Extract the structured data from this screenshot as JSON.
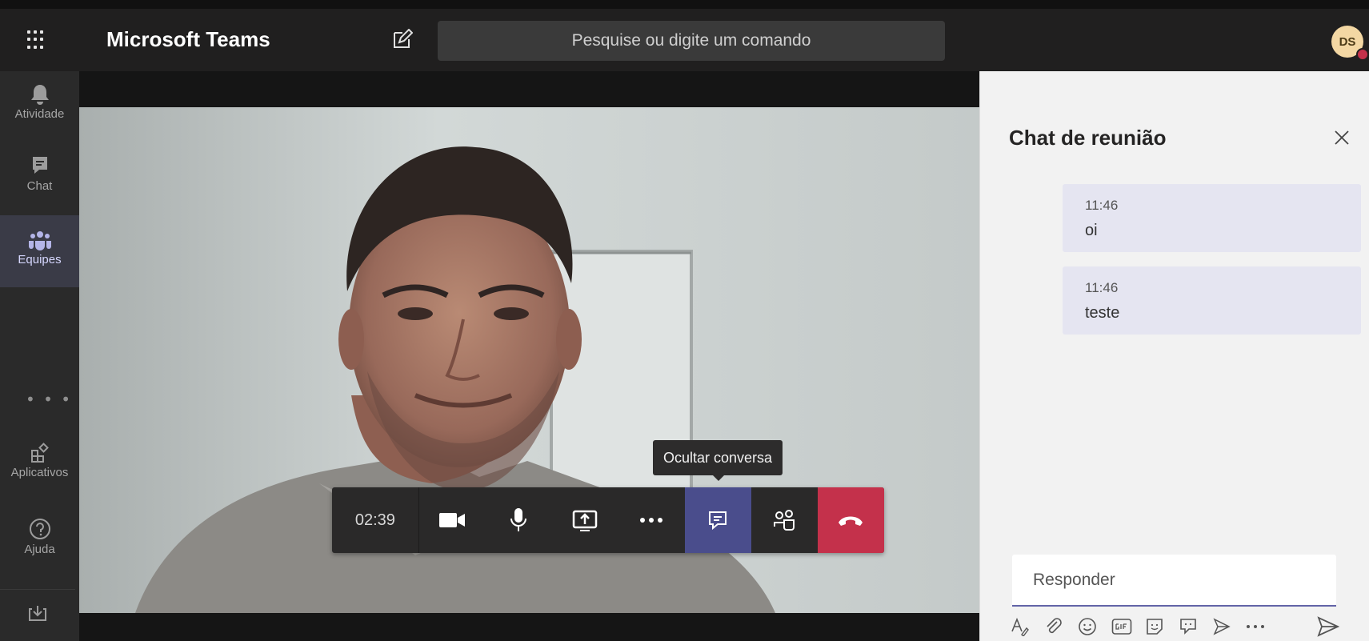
{
  "app": {
    "title": "Microsoft Teams"
  },
  "search": {
    "placeholder": "Pesquise ou digite um comando"
  },
  "user": {
    "initials": "DS",
    "presence_color": "#c4314b"
  },
  "rail": {
    "items": [
      {
        "label": "Atividade",
        "icon": "bell-icon"
      },
      {
        "label": "Chat",
        "icon": "chat-icon"
      },
      {
        "label": "Equipes",
        "icon": "teams-icon",
        "active": true
      },
      {
        "label": "Aplicativos",
        "icon": "apps-icon"
      },
      {
        "label": "Ajuda",
        "icon": "help-icon"
      }
    ],
    "more": "• • •",
    "download_icon": "download-icon"
  },
  "call": {
    "timer": "02:39",
    "tooltip": "Ocultar conversa",
    "controls": [
      "camera-icon",
      "microphone-icon",
      "share-screen-icon",
      "more-options-icon",
      "conversation-icon",
      "participants-icon",
      "hangup-icon"
    ],
    "hangup_color": "#c4314b",
    "active_color": "#4a4d8c"
  },
  "chat": {
    "title": "Chat de reunião",
    "messages": [
      {
        "time": "11:46",
        "text": "oi"
      },
      {
        "time": "11:46",
        "text": "teste"
      }
    ],
    "reply_placeholder": "Responder",
    "tools": [
      "format-icon",
      "attach-icon",
      "emoji-icon",
      "gif-icon",
      "sticker-icon",
      "meet-icon",
      "praise-icon",
      "more-icon",
      "send-icon"
    ]
  }
}
